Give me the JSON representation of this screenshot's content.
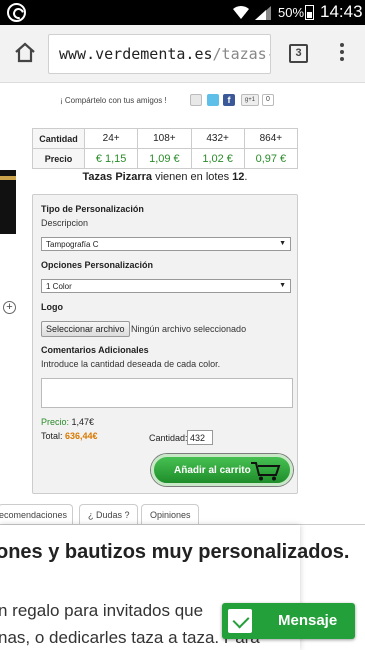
{
  "status": {
    "battery": "50%",
    "time": "14:43"
  },
  "browser": {
    "url_host": "www.verdementa.es",
    "url_path": "/tazas-",
    "tab_count": "3"
  },
  "share": {
    "text": "¡ Compártelo con tus amigos !",
    "gplus": "g+1",
    "count": "0",
    "fb": "f"
  },
  "pricing": {
    "qty_label": "Cantidad",
    "price_label": "Precio",
    "tiers": [
      "24+",
      "108+",
      "432+",
      "864+"
    ],
    "prices": [
      "€ 1,15",
      "1,09 €",
      "1,02 €",
      "0,97 €"
    ]
  },
  "lotes": {
    "product": "Tazas Pizarra",
    "text": " vienen en lotes ",
    "size": "12",
    "end": "."
  },
  "form": {
    "tipo_label": "Tipo de Personalización",
    "tipo_sub": "Descripcion",
    "tipo_value": "Tampografía C",
    "opciones_label": "Opciones Personalización",
    "opciones_value": "1 Color",
    "logo_label": "Logo",
    "file_button": "Seleccionar archivo",
    "file_status": "Ningún archivo seleccionado",
    "comments_label": "Comentarios Adicionales",
    "comments_sub": "Introduce la cantidad deseada de cada color.",
    "precio_label": "Precio:",
    "precio_value": "1,47€",
    "total_label": "Total:",
    "total_value": "636,44€",
    "cantidad_label": "Cantidad:",
    "cantidad_value": "432",
    "cart_button": "Añadir al carrito"
  },
  "tabs": [
    "ecomendaciones",
    "¿ Dudas ?",
    "Opiniones"
  ],
  "content": {
    "heading": "ones y bautizos muy personalizados.",
    "para1": "n regalo para invitados que",
    "para2": "nas, o dedicarles taza a taza. Para"
  },
  "message_button": "Mensaje",
  "colors": {
    "green": "#24a03a",
    "price_green": "#2a8c2a",
    "total_orange": "#d97a00"
  }
}
